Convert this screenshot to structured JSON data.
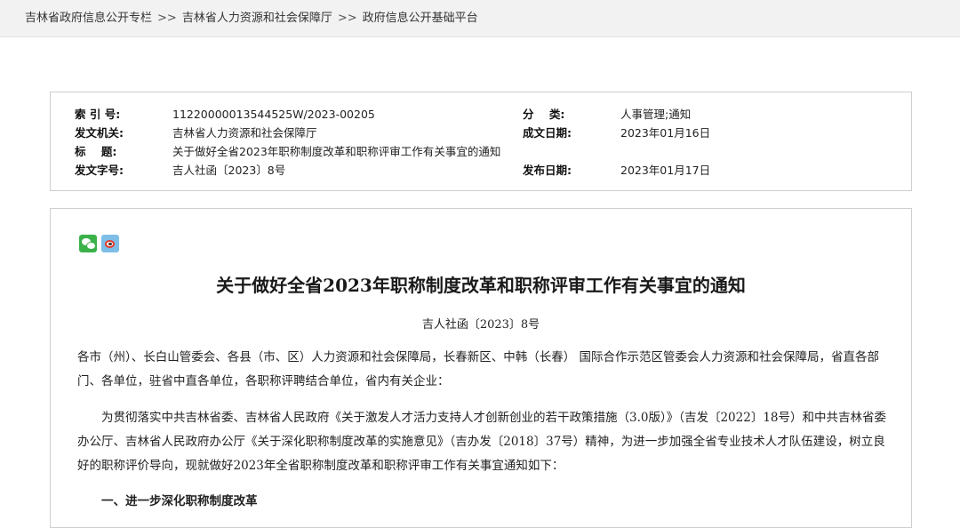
{
  "breadcrumb": {
    "items": [
      "吉林省政府信息公开专栏",
      "吉林省人力资源和社会保障厅",
      "政府信息公开基础平台"
    ],
    "separator": ">>"
  },
  "meta": {
    "index_label": "索 引 号:",
    "index_value": "11220000013544525W/2023-00205",
    "category_label": "分    类:",
    "category_value": "人事管理;通知",
    "issuer_label": "发文机关:",
    "issuer_value": "吉林省人力资源和社会保障厅",
    "created_label": "成文日期:",
    "created_value": "2023年01月16日",
    "title_label": "标    题:",
    "title_value": "关于做好全省2023年职称制度改革和职称评审工作有关事宜的通知",
    "docno_label": "发文字号:",
    "docno_value": "吉人社函〔2023〕8号",
    "published_label": "发布日期:",
    "published_value": "2023年01月17日"
  },
  "share": {
    "icons": [
      "wechat-icon",
      "weibo-icon"
    ]
  },
  "article": {
    "title": "关于做好全省2023年职称制度改革和职称评审工作有关事宜的通知",
    "docno": "吉人社函〔2023〕8号",
    "p1": "各市（州）、长白山管委会、各县（市、区）人力资源和社会保障局，长春新区、中韩（长春） 国际合作示范区管委会人力资源和社会保障局，省直各部门、各单位，驻省中直各单位，各职称评聘结合单位，省内有关企业：",
    "p2": "为贯彻落实中共吉林省委、吉林省人民政府《关于激发人才活力支持人才创新创业的若干政策措施（3.0版）》（吉发〔2022〕18号）和中共吉林省委办公厅、吉林省人民政府办公厅《关于深化职称制度改革的实施意见》（吉办发〔2018〕37号）精神，为进一步加强全省专业技术人才队伍建设，树立良好的职称评价导向，现就做好2023年全省职称制度改革和职称评审工作有关事宜通知如下：",
    "h1": "一、进一步深化职称制度改革"
  }
}
